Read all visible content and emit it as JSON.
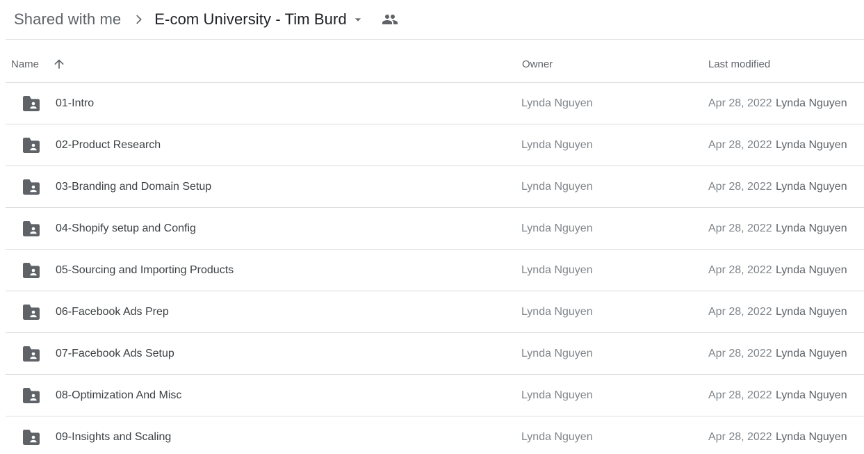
{
  "breadcrumb": {
    "root": "Shared with me",
    "current": "E-com University - Tim Burd",
    "separator_icon": "chevron-right-icon",
    "dropdown_icon": "caret-down-icon",
    "shared_icon": "people-icon"
  },
  "columns": {
    "name": "Name",
    "owner": "Owner",
    "last_modified": "Last modified",
    "sort_icon": "arrow-up-icon"
  },
  "rows": [
    {
      "name": "01-Intro",
      "owner": "Lynda Nguyen",
      "date": "Apr 28, 2022",
      "modified_by": "Lynda Nguyen",
      "icon": "shared-folder-icon"
    },
    {
      "name": "02-Product Research",
      "owner": "Lynda Nguyen",
      "date": "Apr 28, 2022",
      "modified_by": "Lynda Nguyen",
      "icon": "shared-folder-icon"
    },
    {
      "name": "03-Branding and Domain Setup",
      "owner": "Lynda Nguyen",
      "date": "Apr 28, 2022",
      "modified_by": "Lynda Nguyen",
      "icon": "shared-folder-icon"
    },
    {
      "name": "04-Shopify setup and Config",
      "owner": "Lynda Nguyen",
      "date": "Apr 28, 2022",
      "modified_by": "Lynda Nguyen",
      "icon": "shared-folder-icon"
    },
    {
      "name": "05-Sourcing and Importing Products",
      "owner": "Lynda Nguyen",
      "date": "Apr 28, 2022",
      "modified_by": "Lynda Nguyen",
      "icon": "shared-folder-icon"
    },
    {
      "name": "06-Facebook Ads Prep",
      "owner": "Lynda Nguyen",
      "date": "Apr 28, 2022",
      "modified_by": "Lynda Nguyen",
      "icon": "shared-folder-icon"
    },
    {
      "name": "07-Facebook Ads Setup",
      "owner": "Lynda Nguyen",
      "date": "Apr 28, 2022",
      "modified_by": "Lynda Nguyen",
      "icon": "shared-folder-icon"
    },
    {
      "name": "08-Optimization And Misc",
      "owner": "Lynda Nguyen",
      "date": "Apr 28, 2022",
      "modified_by": "Lynda Nguyen",
      "icon": "shared-folder-icon"
    },
    {
      "name": "09-Insights and Scaling",
      "owner": "Lynda Nguyen",
      "date": "Apr 28, 2022",
      "modified_by": "Lynda Nguyen",
      "icon": "shared-folder-icon"
    }
  ],
  "colors": {
    "text_primary": "#3c4043",
    "text_secondary": "#80868b",
    "icon": "#5f6368",
    "divider": "#dadce0"
  }
}
